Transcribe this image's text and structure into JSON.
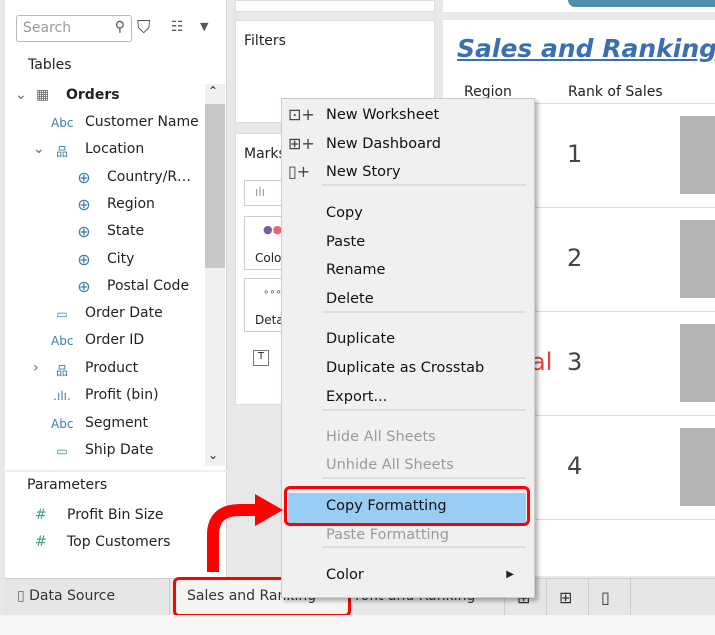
{
  "data_pane": {
    "search_placeholder": "Search",
    "tables_label": "Tables",
    "table": "Orders",
    "fields": [
      {
        "icon": "Abc",
        "label": "Customer Name"
      },
      {
        "icon": "hierarchy",
        "label": "Location"
      },
      {
        "icon": "globe",
        "label": "Country/R…"
      },
      {
        "icon": "globe",
        "label": "Region"
      },
      {
        "icon": "globe",
        "label": "State"
      },
      {
        "icon": "globe",
        "label": "City"
      },
      {
        "icon": "globe",
        "label": "Postal Code"
      },
      {
        "icon": "calendar",
        "label": "Order Date"
      },
      {
        "icon": "Abc",
        "label": "Order ID"
      },
      {
        "icon": "hierarchy",
        "label": "Product"
      },
      {
        "icon": "bin",
        "label": "Profit (bin)"
      },
      {
        "icon": "Abc",
        "label": "Segment"
      },
      {
        "icon": "calendar",
        "label": "Ship Date"
      }
    ],
    "parameters_label": "Parameters",
    "parameters": [
      "Profit Bin Size",
      "Top Customers"
    ]
  },
  "shelves": {
    "filters": "Filters",
    "marks": "Marks",
    "color": "Colo",
    "detail": "Deta"
  },
  "view": {
    "title": "Sales and Ranking b",
    "col_region": "Region",
    "col_rank": "Rank of Sales",
    "ranks": [
      "1",
      "2",
      "3",
      "4"
    ],
    "region_partial": "al"
  },
  "menu": {
    "items": [
      {
        "label": "New Worksheet",
        "enabled": true
      },
      {
        "label": "New Dashboard",
        "enabled": true
      },
      {
        "label": "New Story",
        "enabled": true
      },
      {
        "label": "Copy",
        "enabled": true
      },
      {
        "label": "Paste",
        "enabled": true
      },
      {
        "label": "Rename",
        "enabled": true
      },
      {
        "label": "Delete",
        "enabled": true
      },
      {
        "label": "Duplicate",
        "enabled": true
      },
      {
        "label": "Duplicate as Crosstab",
        "enabled": true
      },
      {
        "label": "Export...",
        "enabled": true
      },
      {
        "label": "Hide All Sheets",
        "enabled": false
      },
      {
        "label": "Unhide All Sheets",
        "enabled": false
      },
      {
        "label": "Copy Formatting",
        "enabled": true,
        "highlighted": true
      },
      {
        "label": "Paste Formatting",
        "enabled": false
      },
      {
        "label": "Color",
        "enabled": true,
        "submenu": true
      }
    ]
  },
  "tabs": {
    "data_source": "Data Source",
    "sheets": [
      "Sales and Ranking",
      "Profit and Ranking"
    ],
    "active": "Sales and Ranking"
  },
  "colors": {
    "title": "#3a6fb0",
    "highlight": "#99cdf5",
    "annotation": "#ff0000"
  }
}
